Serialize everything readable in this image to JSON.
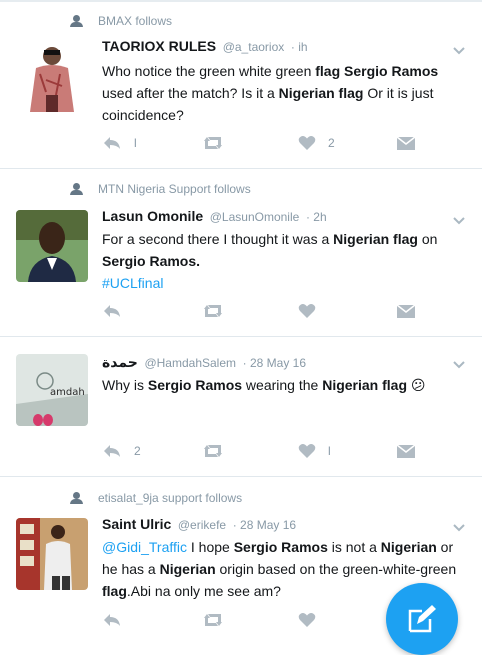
{
  "tweets": [
    {
      "social_context": "BMAX follows",
      "name": "TAORIOX RULES",
      "handle": "@a_taoriox",
      "time": "· ih",
      "text": [
        {
          "t": "Who notice the green white green "
        },
        {
          "t": "flag",
          "b": true
        },
        {
          "t": " "
        },
        {
          "t": "Sergio Ramos",
          "b": true
        },
        {
          "t": " used after the match? Is it a "
        },
        {
          "t": "Nigerian flag",
          "b": true
        },
        {
          "t": " Or it is just coincidence?"
        }
      ],
      "reply_count": "l",
      "retweet_count": "",
      "like_count": "2"
    },
    {
      "social_context": "MTN Nigeria Support follows",
      "name": "Lasun Omonile",
      "handle": "@LasunOmonile",
      "time": "· 2h",
      "text": [
        {
          "t": "For a second there I thought it was a "
        },
        {
          "t": "Nigerian flag",
          "b": true
        },
        {
          "t": " on "
        },
        {
          "t": "Sergio Ramos.",
          "b": true
        },
        {
          "t": "\n"
        },
        {
          "t": "#UCLfinal",
          "link": true
        }
      ],
      "reply_count": "",
      "retweet_count": "",
      "like_count": ""
    },
    {
      "social_context": "",
      "name": "حمدة",
      "handle": "@HamdahSalem",
      "time": "· 28 May 16",
      "text": [
        {
          "t": "Why is "
        },
        {
          "t": "Sergio Ramos",
          "b": true
        },
        {
          "t": " wearing the "
        },
        {
          "t": "Nigerian flag",
          "b": true
        },
        {
          "t": " 😕"
        }
      ],
      "avatar_caption": "amdah",
      "reply_count": "2",
      "retweet_count": "",
      "like_count": "l"
    },
    {
      "social_context": "etisalat_9ja support follows",
      "name": "Saint Ulric",
      "handle": "@erikefe",
      "time": "· 28 May 16",
      "text": [
        {
          "t": "@Gidi_Traffic",
          "link": true
        },
        {
          "t": " I hope "
        },
        {
          "t": "Sergio Ramos",
          "b": true
        },
        {
          "t": " is not a "
        },
        {
          "t": "Nigerian",
          "b": true
        },
        {
          "t": " or he has a "
        },
        {
          "t": "Nigerian",
          "b": true
        },
        {
          "t": " origin based on the green-white-green "
        },
        {
          "t": "flag",
          "b": true
        },
        {
          "t": ".Abi na only me see am?"
        }
      ],
      "reply_count": "",
      "retweet_count": "",
      "like_count": ""
    }
  ],
  "fab": {
    "icon": "compose-icon",
    "color": "#1da1f2"
  },
  "colors": {
    "accent": "#1da1f2",
    "muted": "#8899a6",
    "icon": "#b1bbc3"
  }
}
